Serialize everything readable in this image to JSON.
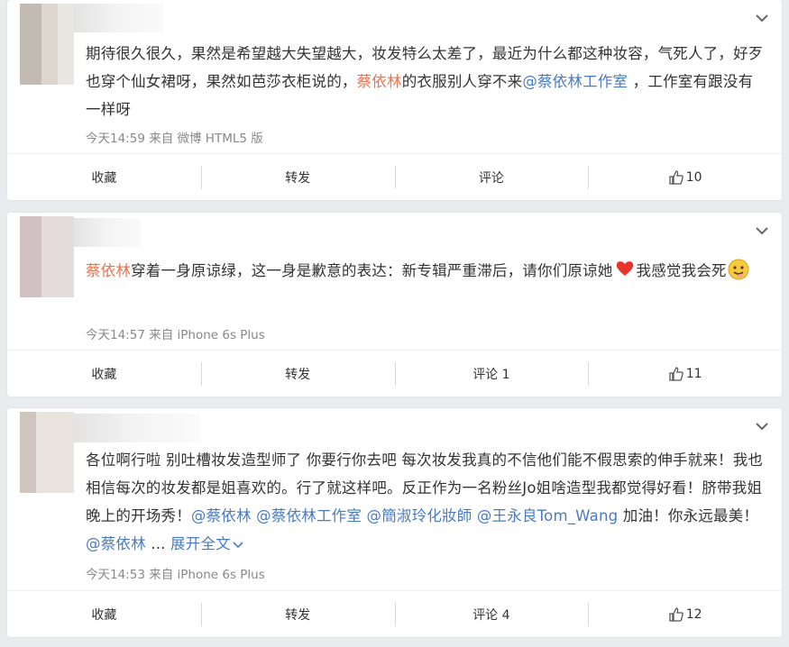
{
  "posts": [
    {
      "text_parts": [
        {
          "t": "期待很久很久，果然是希望越大失望越大，妆发特么太差了，最近为什么都这种妆容，气死人了，好歹也穿个仙女裙呀，果然如芭莎衣柜说的，"
        },
        {
          "t": "蔡依林",
          "kind": "link"
        },
        {
          "t": "的衣服别人穿不来"
        },
        {
          "t": "@蔡依林工作室",
          "kind": "at"
        },
        {
          "t": " ，工作室有跟没有一样呀"
        }
      ],
      "time": "今天14:59",
      "from_label": "来自",
      "source": "微博 HTML5 版",
      "actions": {
        "collect": "收藏",
        "repost": "转发",
        "comment": "评论",
        "like": "10"
      }
    },
    {
      "text_parts": [
        {
          "t": "蔡依林",
          "kind": "link"
        },
        {
          "t": "穿着一身原谅绿，这一身是歉意的表达：新专辑严重滞后，请你们原谅她"
        },
        {
          "t": "",
          "kind": "heart"
        },
        {
          "t": "我感觉我会死"
        },
        {
          "t": "",
          "kind": "face"
        }
      ],
      "time": "今天14:57",
      "from_label": "来自",
      "source": "iPhone 6s Plus",
      "actions": {
        "collect": "收藏",
        "repost": "转发",
        "comment": "评论 1",
        "like": "11"
      }
    },
    {
      "text_parts": [
        {
          "t": "各位啊行啦 别吐槽妆发造型师了 你要行你去吧 每次妆发我真的不信他们能不假思索的伸手就来！我也相信每次的妆发都是姐喜欢的。行了就这样吧。反正作为一名粉丝Jo姐啥造型我都觉得好看！脐带我姐晚上的开场秀！"
        },
        {
          "t": "@蔡依林",
          "kind": "at"
        },
        {
          "t": " "
        },
        {
          "t": "@蔡依林工作室",
          "kind": "at"
        },
        {
          "t": " "
        },
        {
          "t": "@簡淑玲化妝師",
          "kind": "at"
        },
        {
          "t": " "
        },
        {
          "t": "@王永良Tom_Wang",
          "kind": "at"
        },
        {
          "t": " 加油！你永远最美！"
        },
        {
          "t": "@蔡依林",
          "kind": "at"
        },
        {
          "t": " ... "
        },
        {
          "t": "展开全文",
          "kind": "more"
        }
      ],
      "time": "今天14:53",
      "from_label": "来自",
      "source": "iPhone 6s Plus",
      "actions": {
        "collect": "收藏",
        "repost": "转发",
        "comment": "评论 4",
        "like": "12"
      }
    }
  ],
  "colors": {
    "link": "#eb7350",
    "at": "#4a7bc2",
    "meta": "#888888",
    "background": "#e9ebee"
  }
}
